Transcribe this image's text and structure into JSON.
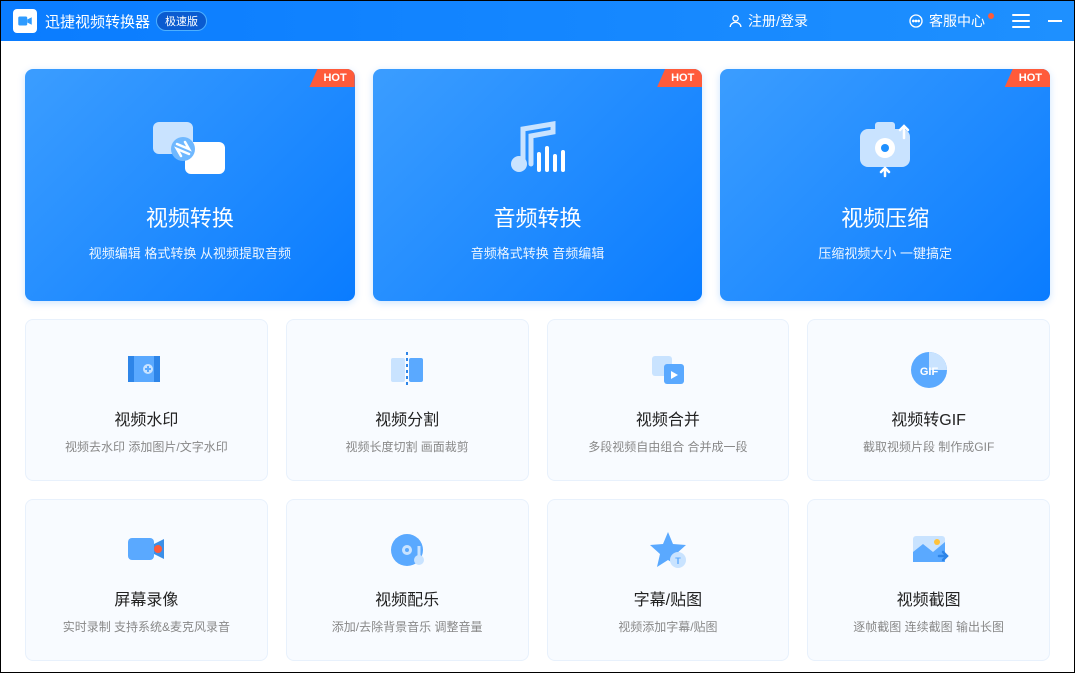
{
  "titlebar": {
    "app_name": "迅捷视频转换器",
    "badge": "极速版",
    "login": "注册/登录",
    "support": "客服中心"
  },
  "hot_label": "HOT",
  "hero": [
    {
      "title": "视频转换",
      "desc": "视频编辑 格式转换 从视频提取音频"
    },
    {
      "title": "音频转换",
      "desc": "音频格式转换 音频编辑"
    },
    {
      "title": "视频压缩",
      "desc": "压缩视频大小 一键搞定"
    }
  ],
  "grid": [
    {
      "title": "视频水印",
      "desc": "视频去水印 添加图片/文字水印"
    },
    {
      "title": "视频分割",
      "desc": "视频长度切割 画面裁剪"
    },
    {
      "title": "视频合并",
      "desc": "多段视频自由组合 合并成一段"
    },
    {
      "title": "视频转GIF",
      "desc": "截取视频片段 制作成GIF"
    },
    {
      "title": "屏幕录像",
      "desc": "实时录制 支持系统&麦克风录音"
    },
    {
      "title": "视频配乐",
      "desc": "添加/去除背景音乐 调整音量"
    },
    {
      "title": "字幕/贴图",
      "desc": "视频添加字幕/贴图"
    },
    {
      "title": "视频截图",
      "desc": "逐帧截图 连续截图 输出长图"
    }
  ]
}
